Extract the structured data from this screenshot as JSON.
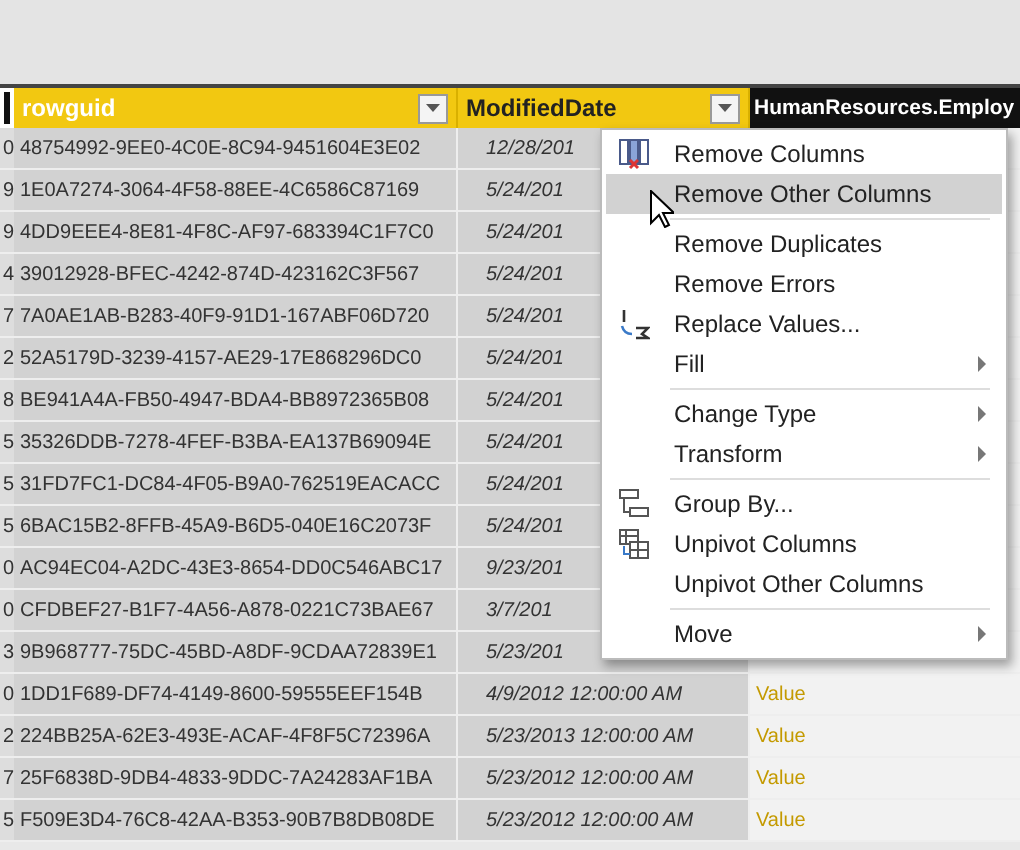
{
  "table": {
    "columns": [
      {
        "label": "rowguid",
        "filter": true
      },
      {
        "label": "ModifiedDate",
        "filter": true
      },
      {
        "label": "HumanResources.Employ",
        "filter": false
      }
    ],
    "rows": [
      {
        "column_1": "0",
        "rowguid": "48754992-9EE0-4C0E-8C94-9451604E3E02",
        "modified": "12/28/201"
      },
      {
        "column_1": "9",
        "rowguid": "1E0A7274-3064-4F58-88EE-4C6586C87169",
        "modified": "5/24/201"
      },
      {
        "column_1": "9",
        "rowguid": "4DD9EEE4-8E81-4F8C-AF97-683394C1F7C0",
        "modified": "5/24/201"
      },
      {
        "column_1": "4",
        "rowguid": "39012928-BFEC-4242-874D-423162C3F567",
        "modified": "5/24/201"
      },
      {
        "column_1": "7",
        "rowguid": "7A0AE1AB-B283-40F9-91D1-167ABF06D720",
        "modified": "5/24/201"
      },
      {
        "column_1": "2",
        "rowguid": "52A5179D-3239-4157-AE29-17E868296DC0",
        "modified": "5/24/201"
      },
      {
        "column_1": "8",
        "rowguid": "BE941A4A-FB50-4947-BDA4-BB8972365B08",
        "modified": "5/24/201"
      },
      {
        "column_1": "5",
        "rowguid": "35326DDB-7278-4FEF-B3BA-EA137B69094E",
        "modified": "5/24/201"
      },
      {
        "column_1": "5",
        "rowguid": "31FD7FC1-DC84-4F05-B9A0-762519EACACC",
        "modified": "5/24/201"
      },
      {
        "column_1": "5",
        "rowguid": "6BAC15B2-8FFB-45A9-B6D5-040E16C2073F",
        "modified": "5/24/201"
      },
      {
        "column_1": "0",
        "rowguid": "AC94EC04-A2DC-43E3-8654-DD0C546ABC17",
        "modified": "9/23/201"
      },
      {
        "column_1": "0",
        "rowguid": "CFDBEF27-B1F7-4A56-A878-0221C73BAE67",
        "modified": "3/7/201"
      },
      {
        "column_1": "3",
        "rowguid": "9B968777-75DC-45BD-A8DF-9CDAA72839E1",
        "modified": "5/23/201"
      },
      {
        "column_1": "0",
        "rowguid": "1DD1F689-DF74-4149-8600-59555EEF154B",
        "modified": "4/9/2012 12:00:00 AM",
        "column_4": "Value"
      },
      {
        "column_1": "2",
        "rowguid": "224BB25A-62E3-493E-ACAF-4F8F5C72396A",
        "modified": "5/23/2013 12:00:00 AM",
        "column_4": "Value"
      },
      {
        "column_1": "7",
        "rowguid": "25F6838D-9DB4-4833-9DDC-7A24283AF1BA",
        "modified": "5/23/2012 12:00:00 AM",
        "column_4": "Value"
      },
      {
        "column_1": "5",
        "rowguid": "F509E3D4-76C8-42AA-B353-90B7B8DB08DE",
        "modified": "5/23/2012 12:00:00 AM",
        "column_4": "Value"
      }
    ]
  },
  "context_menu": {
    "items": [
      {
        "kind": "item",
        "label": "Remove Columns",
        "selected": false,
        "submenu": false
      },
      {
        "kind": "item",
        "label": "Remove Other Columns",
        "selected": true,
        "submenu": false
      },
      {
        "kind": "separator"
      },
      {
        "kind": "item",
        "label": "Remove Duplicates",
        "selected": false,
        "submenu": false
      },
      {
        "kind": "item",
        "label": "Remove Errors",
        "selected": false,
        "submenu": false
      },
      {
        "kind": "item",
        "label": "Replace Values...",
        "selected": false,
        "submenu": false
      },
      {
        "kind": "item",
        "label": "Fill",
        "selected": false,
        "submenu": true
      },
      {
        "kind": "separator"
      },
      {
        "kind": "item",
        "label": "Change Type",
        "selected": false,
        "submenu": true
      },
      {
        "kind": "item",
        "label": "Transform",
        "selected": false,
        "submenu": true
      },
      {
        "kind": "separator"
      },
      {
        "kind": "item",
        "label": "Group By...",
        "selected": false,
        "submenu": false
      },
      {
        "kind": "item",
        "label": "Unpivot Columns",
        "selected": false,
        "submenu": false
      },
      {
        "kind": "item",
        "label": "Unpivot Other Columns",
        "selected": false,
        "submenu": false
      },
      {
        "kind": "separator"
      },
      {
        "kind": "item",
        "label": "Move",
        "selected": false,
        "submenu": true
      }
    ]
  }
}
